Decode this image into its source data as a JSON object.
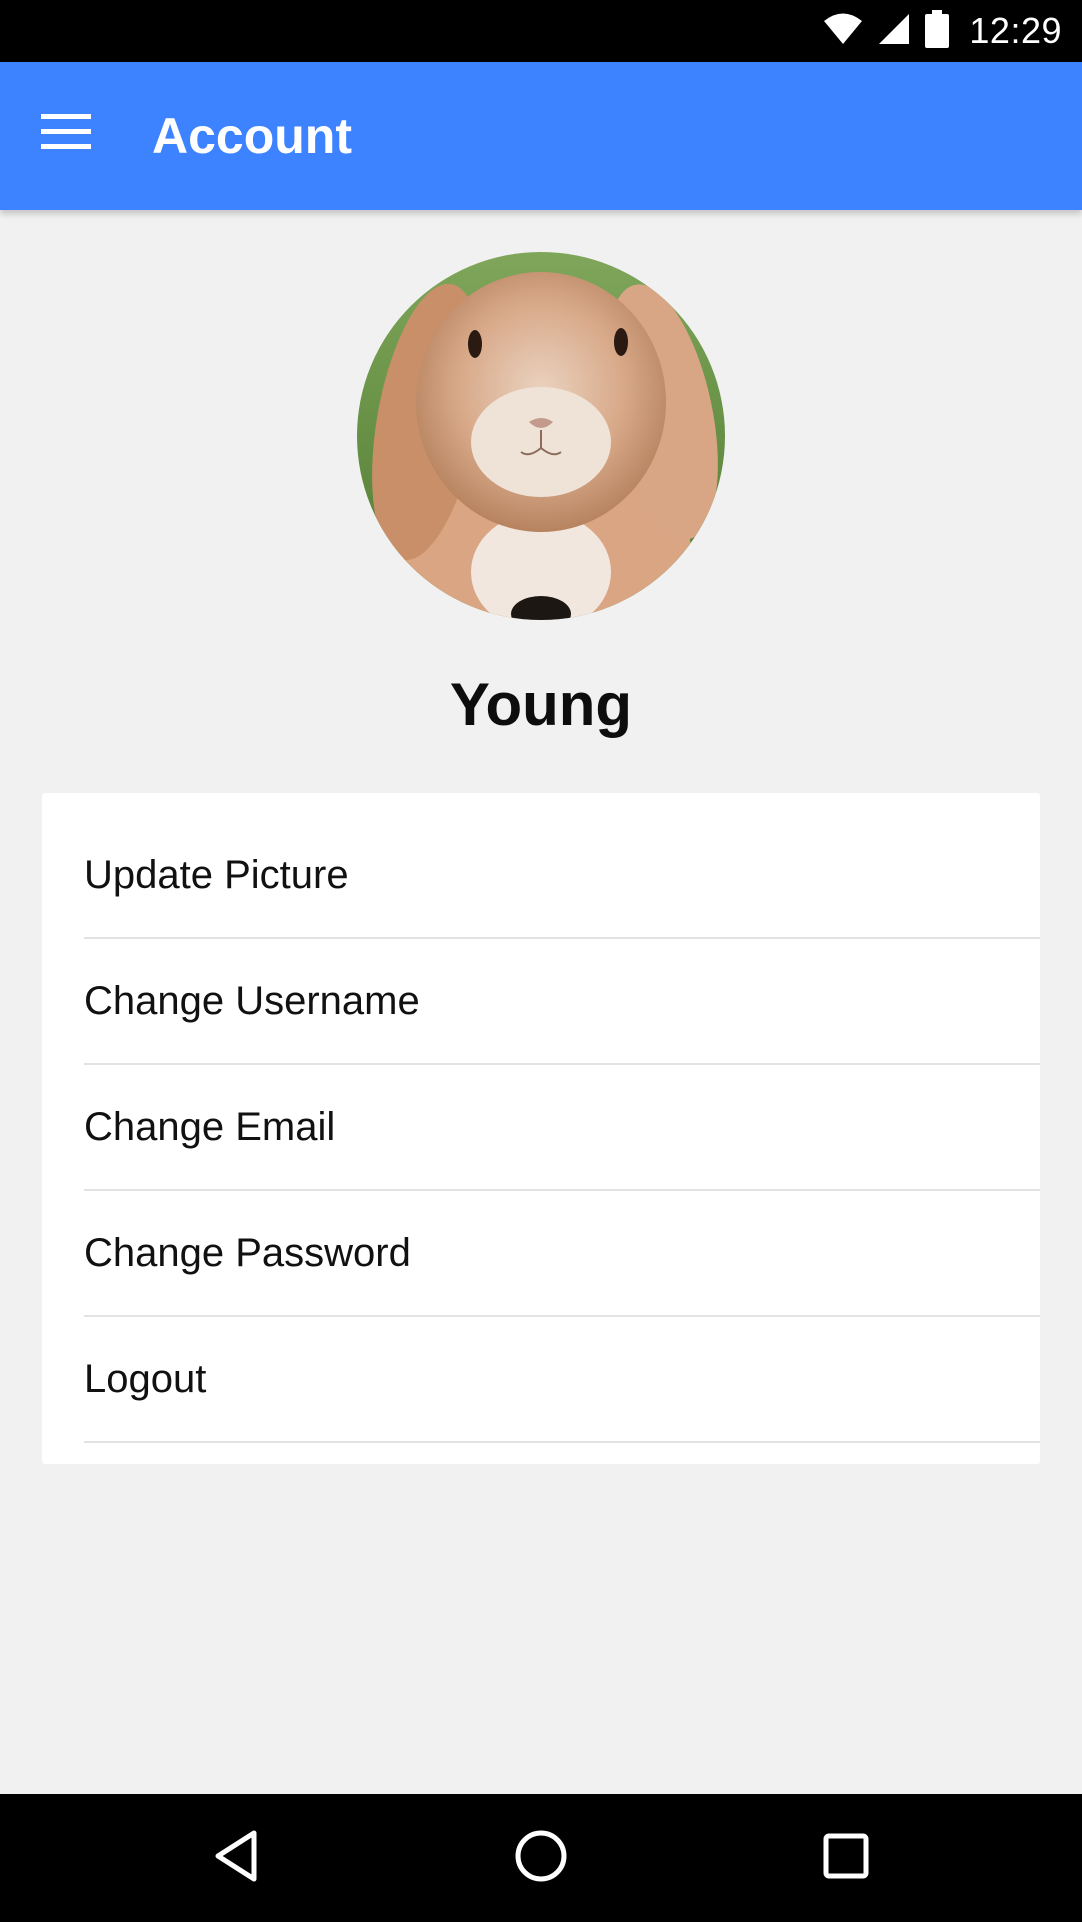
{
  "status_bar": {
    "time": "12:29",
    "icons": [
      "wifi-icon",
      "signal-icon",
      "battery-icon"
    ]
  },
  "app_bar": {
    "title": "Account",
    "menu_icon": "hamburger-menu-icon",
    "color": "#3d83ff"
  },
  "profile": {
    "avatar": "rabbit-avatar-image",
    "name": "Young"
  },
  "menu": {
    "items": [
      {
        "label": "Update Picture"
      },
      {
        "label": "Change Username"
      },
      {
        "label": "Change Email"
      },
      {
        "label": "Change Password"
      },
      {
        "label": "Logout"
      }
    ]
  },
  "nav_bar": {
    "icons": [
      "back-icon",
      "home-icon",
      "recents-icon"
    ]
  }
}
